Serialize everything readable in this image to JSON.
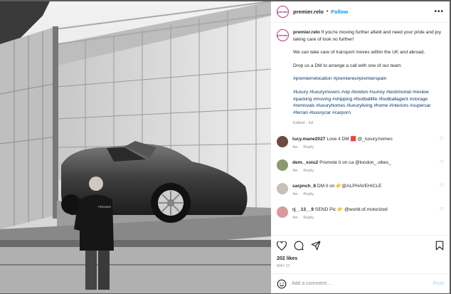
{
  "header": {
    "username": "premier.relo",
    "separator": "•",
    "follow_label": "Follow",
    "more_label": "•••",
    "avatar_text": "premier"
  },
  "caption": {
    "username": "premier.relo",
    "line1": "If you're moving further afield and need your pride and joy taking care of look no further!",
    "line2": "We can take care of transport moves within the UK and abroad.",
    "line3": "Drop us a DM to arrange a call with one of our team.",
    "hashtags1": "#premierrelocation #premieres#premierspain",
    "hashtags2": "#luxury #luxurymovers #vip #london #surrey #testimonial #review #packing #moving #shipping #footballlife #footballagent #storage #removals #luxuryhomes #luxuryliving #home #interiors #supercar #ferrari #luxurycar #carporn",
    "meta": "Edited · 6d"
  },
  "comments": [
    {
      "username": "lucy.mane2027",
      "text": "Love it DM 🟥 @_luxury.homes",
      "age": "4w",
      "reply": "Reply",
      "avatar_color": "#6b4b3e"
    },
    {
      "username": "dem._xoiu2",
      "text": "Promote it on ca @london_.vibes_",
      "age": "4w",
      "reply": "Reply",
      "avatar_color": "#8a9a6b"
    },
    {
      "username": "sarpnch_8",
      "text": "DM it on 👉@ALPHAVEHICLE",
      "age": "4w",
      "reply": "Reply",
      "avatar_color": "#c7c0b8"
    },
    {
      "username": "rj__13__9",
      "text": "SEND Pic 👉 @world.of.motorized",
      "age": "4w",
      "reply": "Reply",
      "avatar_color": "#d89a9a"
    }
  ],
  "actions": {
    "likes": "202 likes",
    "date": "MAY 21"
  },
  "add_comment": {
    "placeholder": "Add a comment…",
    "post_label": "Post"
  }
}
